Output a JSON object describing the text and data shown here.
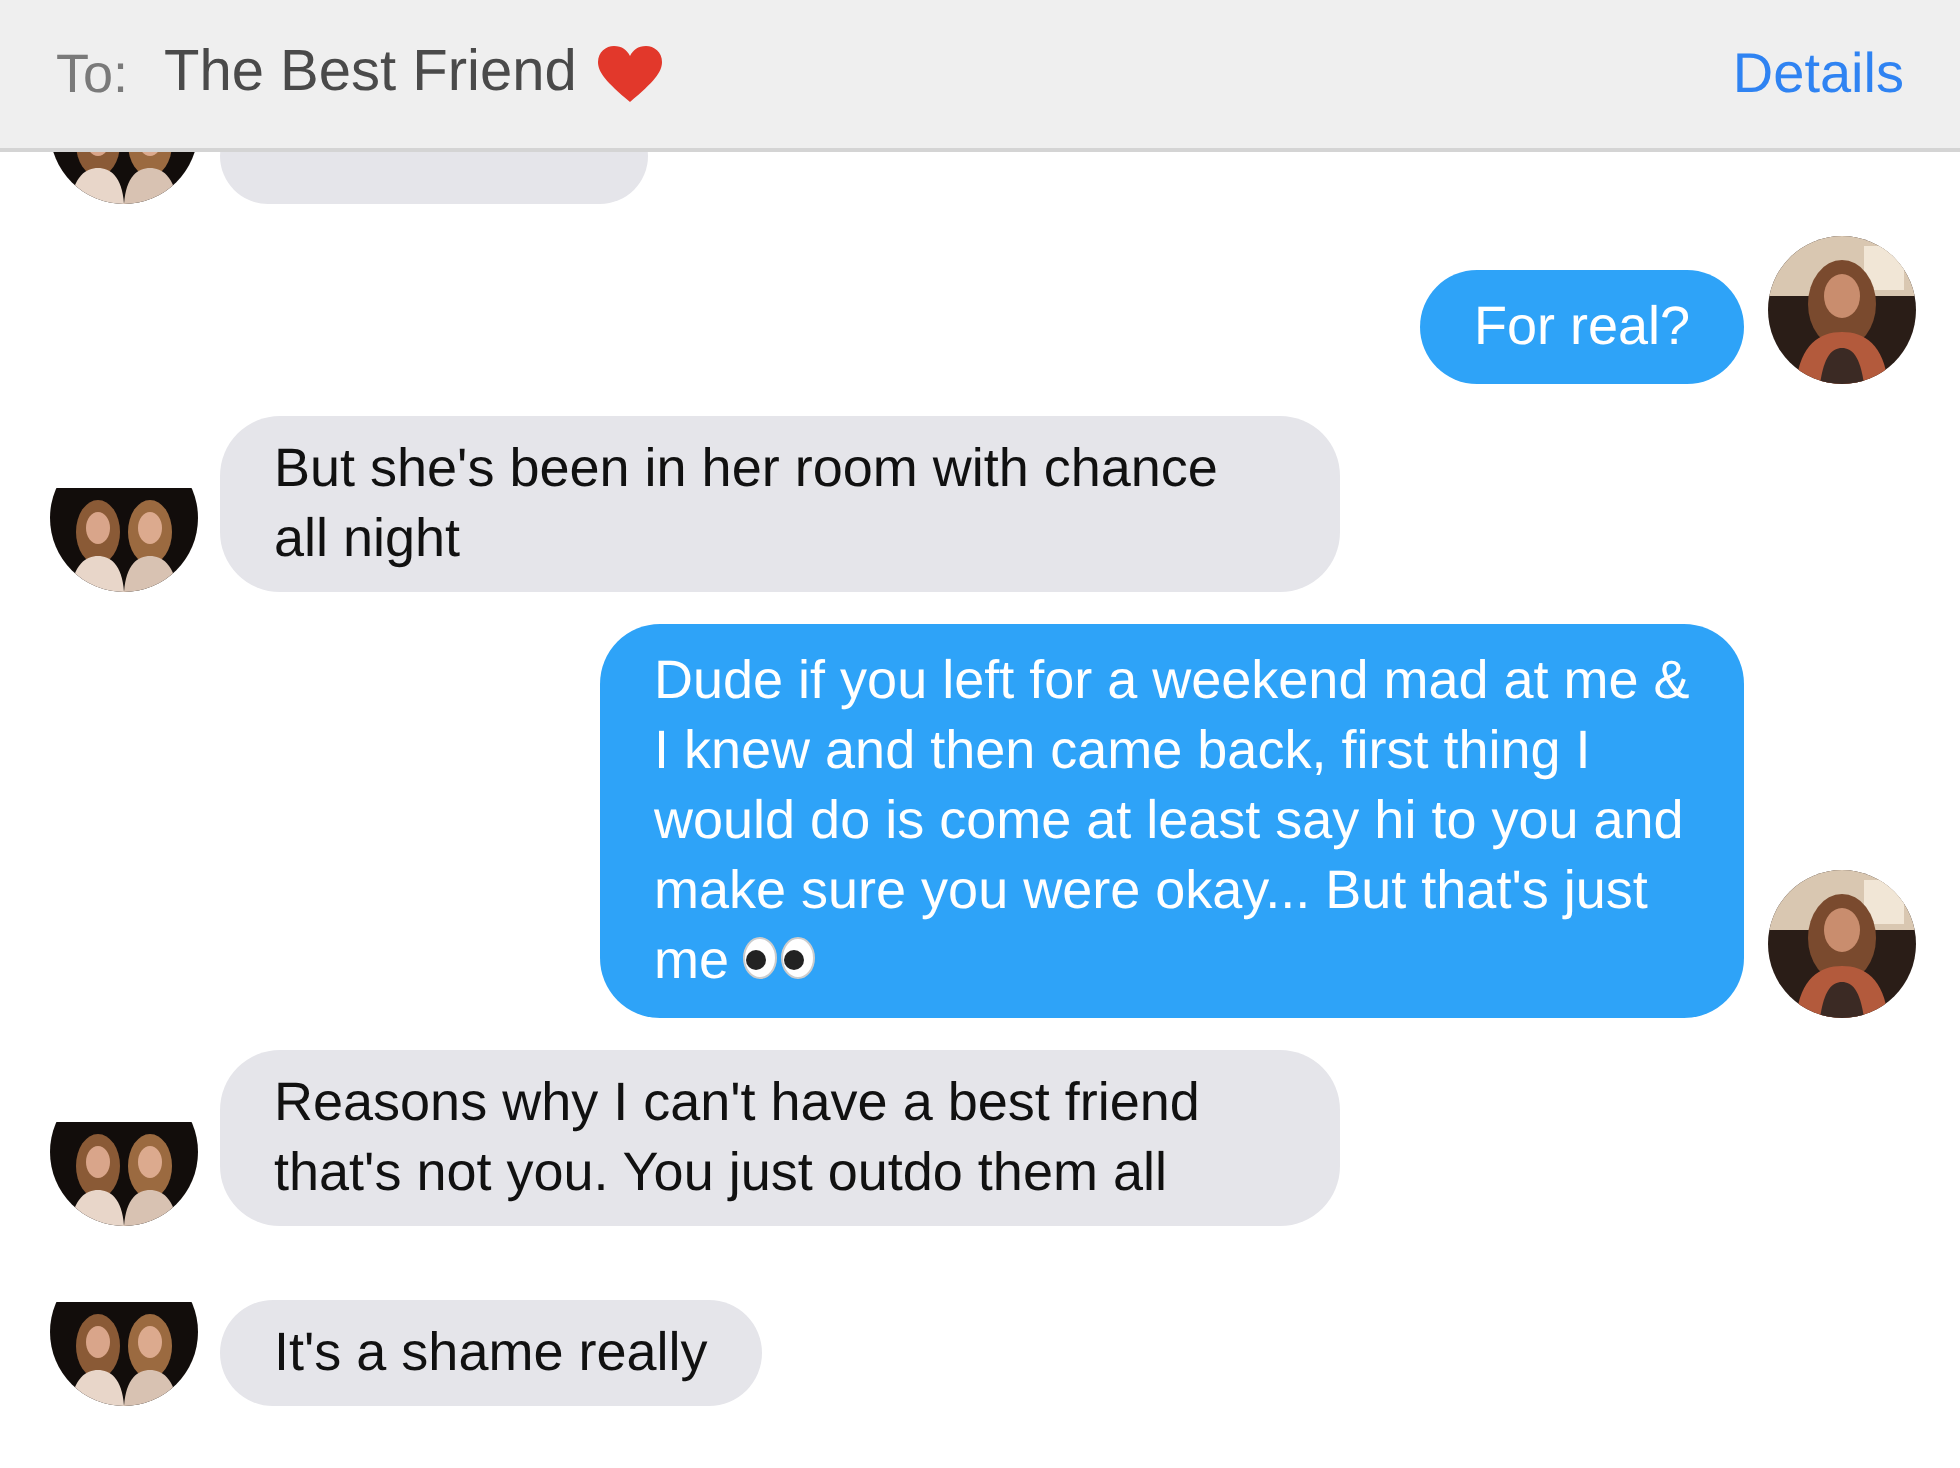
{
  "header": {
    "to_label": "To:",
    "recipient": "The Best Friend",
    "recipient_emoji": {
      "kind": "heart"
    },
    "details": "Details"
  },
  "messages": [
    {
      "kind": "received"
    },
    {
      "kind": "sent",
      "text": "For real?"
    },
    {
      "kind": "received",
      "text": "But she's been in her room with chance all night"
    },
    {
      "kind": "sent",
      "text": "Dude if you left for a weekend mad at me & I knew and then came back, first thing I would do is come at least say hi to you and make sure you were okay... But that's just me",
      "emoji": {
        "kind": "eyes"
      }
    },
    {
      "kind": "received",
      "text": "Reasons why I can't have a best friend that's not you. You just outdo them all"
    },
    {
      "kind": "received",
      "text": "It's a shame really"
    }
  ]
}
